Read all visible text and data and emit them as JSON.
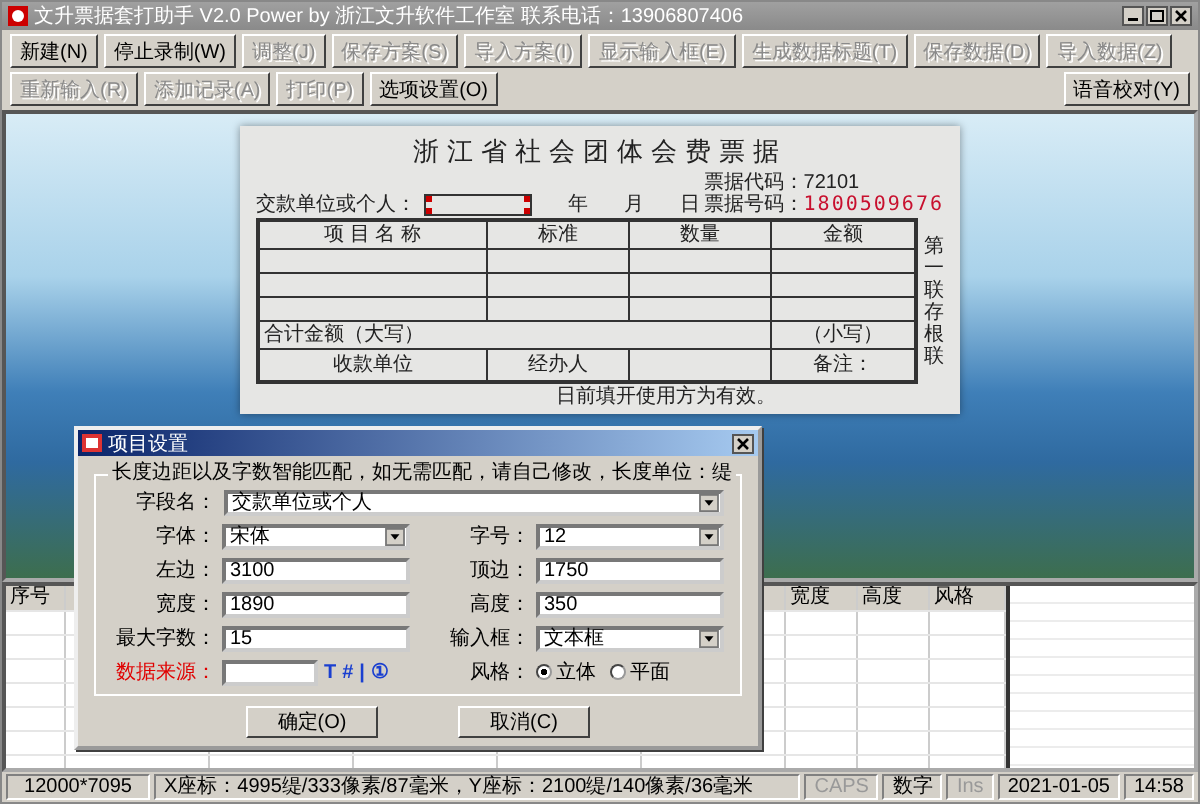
{
  "window": {
    "title": "文升票据套打助手 V2.0 Power by 浙江文升软件工作室 联系电话：13906807406"
  },
  "toolbar": {
    "buttons": [
      {
        "label": "新建(N)",
        "disabled": false
      },
      {
        "label": "停止录制(W)",
        "disabled": false
      },
      {
        "label": "调整(J)",
        "disabled": true
      },
      {
        "label": "保存方案(S)",
        "disabled": true
      },
      {
        "label": "导入方案(I)",
        "disabled": true
      },
      {
        "label": "显示输入框(E)",
        "disabled": true
      },
      {
        "label": "生成数据标题(T)",
        "disabled": true
      },
      {
        "label": "保存数据(D)",
        "disabled": true
      },
      {
        "label": "导入数据(Z)",
        "disabled": true
      },
      {
        "label": "重新输入(R)",
        "disabled": true
      },
      {
        "label": "添加记录(A)",
        "disabled": true
      },
      {
        "label": "打印(P)",
        "disabled": true
      },
      {
        "label": "选项设置(O)",
        "disabled": false
      }
    ],
    "right_button": {
      "label": "语音校对(Y)",
      "disabled": false
    }
  },
  "receipt": {
    "title": "浙江省社会团体会费票据",
    "code_label": "票据代码：72101",
    "number_label": "票据号码：",
    "number": "1800509676",
    "payer_label": "交款单位或个人：",
    "date_parts": [
      "年",
      "月",
      "日"
    ],
    "columns": [
      "项 目 名 称",
      "标准",
      "数量",
      "金额"
    ],
    "total_upper": "合计金额（大写）",
    "total_lower": "（小写）",
    "payee": "收款单位",
    "handler": "经办人",
    "remark": "备注：",
    "side_text": "第一联存根联",
    "footnote": "日前填开使用方为有效。"
  },
  "dialog": {
    "title": "项目设置",
    "hint": "长度边距以及字数智能匹配，如无需匹配，请自己修改，长度单位：缇",
    "field_name": {
      "label": "字段名：",
      "value": "交款单位或个人"
    },
    "fields": [
      {
        "label": "字体：",
        "value": "宋体",
        "kind": "combo"
      },
      {
        "label": "字号：",
        "value": "12",
        "kind": "combo"
      },
      {
        "label": "左边：",
        "value": "3100",
        "kind": "text"
      },
      {
        "label": "顶边：",
        "value": "1750",
        "kind": "text"
      },
      {
        "label": "宽度：",
        "value": "1890",
        "kind": "text"
      },
      {
        "label": "高度：",
        "value": "350",
        "kind": "text"
      },
      {
        "label": "最大字数：",
        "value": "15",
        "kind": "text"
      },
      {
        "label": "输入框：",
        "value": "文本框",
        "kind": "combo"
      }
    ],
    "source": {
      "label": "数据来源：",
      "tools": [
        "T",
        "#",
        "|",
        "①"
      ]
    },
    "style_label": "风格：",
    "style_options": [
      {
        "label": "立体",
        "selected": true
      },
      {
        "label": "平面",
        "selected": false
      }
    ],
    "buttons": [
      "确定(O)",
      "取消(C)"
    ]
  },
  "table": {
    "columns": [
      "序号",
      "",
      "",
      "",
      "",
      "",
      "宽度",
      "高度",
      "风格"
    ]
  },
  "status_bar": [
    {
      "text": "12000*7095",
      "disabled": false
    },
    {
      "text": "X座标：4995缇/333像素/87毫米，Y座标：2100缇/140像素/36毫米",
      "disabled": false
    },
    {
      "text": "CAPS",
      "disabled": true
    },
    {
      "text": "数字",
      "disabled": false
    },
    {
      "text": "Ins",
      "disabled": true
    },
    {
      "text": "2021-01-05",
      "disabled": false
    },
    {
      "text": "14:58",
      "disabled": false
    }
  ]
}
